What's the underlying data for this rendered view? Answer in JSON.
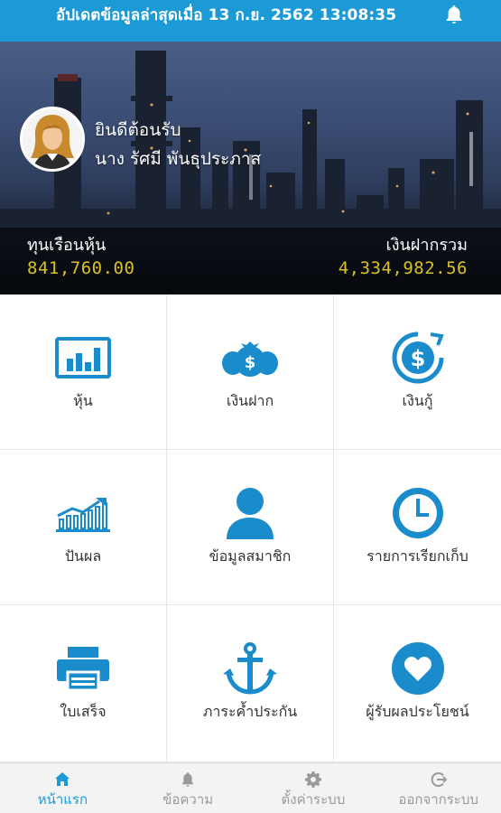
{
  "header": {
    "updated_text": "อัปเดตข้อมูลล่าสุดเมื่อ 13 ก.ย. 2562 13:08:35",
    "bell_icon": "bell-icon"
  },
  "profile": {
    "welcome": "ยินดีต้อนรับ",
    "name": "นาง รัศมี พันธุประภาส",
    "avatar_icon": "female-avatar-icon"
  },
  "summary": {
    "shares_label": "ทุนเรือนหุ้น",
    "shares_value": "841,760.00",
    "deposit_label": "เงินฝากรวม",
    "deposit_value": "4,334,982.56",
    "value_color": "#d9c128"
  },
  "menu": [
    {
      "label": "หุ้น",
      "icon": "bar-chart-icon"
    },
    {
      "label": "เงินฝาก",
      "icon": "money-bags-icon"
    },
    {
      "label": "เงินกู้",
      "icon": "loan-dollar-icon"
    },
    {
      "label": "ปันผล",
      "icon": "growth-chart-icon"
    },
    {
      "label": "ข้อมูลสมาชิก",
      "icon": "user-icon"
    },
    {
      "label": "รายการเรียกเก็บ",
      "icon": "clock-icon"
    },
    {
      "label": "ใบเสร็จ",
      "icon": "printer-icon"
    },
    {
      "label": "ภาระค้ำประกัน",
      "icon": "anchor-icon"
    },
    {
      "label": "ผู้รับผลประโยชน์",
      "icon": "heart-icon"
    }
  ],
  "bottom_nav": [
    {
      "label": "หน้าแรก",
      "icon": "home-icon",
      "active": true
    },
    {
      "label": "ข้อความ",
      "icon": "bell-icon",
      "active": false
    },
    {
      "label": "ตั้งค่าระบบ",
      "icon": "gear-icon",
      "active": false
    },
    {
      "label": "ออกจากระบบ",
      "icon": "logout-icon",
      "active": false
    }
  ],
  "colors": {
    "accent": "#1b9ad6",
    "icon": "#1a8ccc",
    "inactive": "#9a9a9a"
  }
}
